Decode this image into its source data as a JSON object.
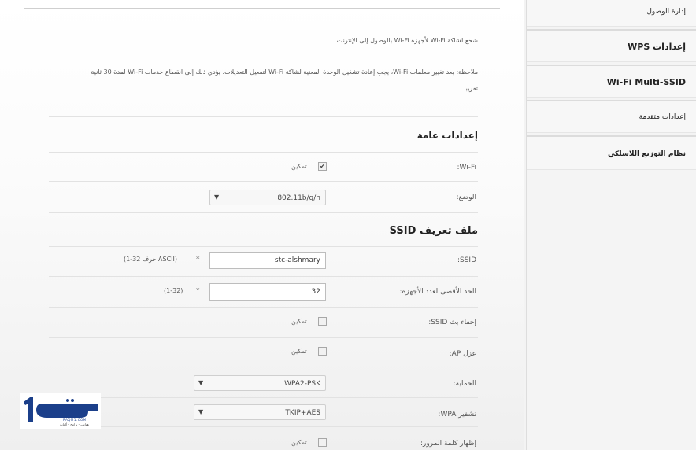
{
  "intro": {
    "line1": "شحع لشاكة Wi-Fi لأجهزة Wi-Fi بالوصول إلى الإنترنت.",
    "line2": "ملاحظة: بعد تغيير معلمات Wi-Fi، يجب إعادة تشغيل الوحدة المعنية لشاكة Wi-Fi لتفعيل التعديلات. يؤدي ذلك إلى انقطاع خدمات Wi-Fi لمدة 30 ثانية",
    "line3": "تقريبا."
  },
  "general": {
    "heading": "إعدادات عامة",
    "wifi_label": "Wi-Fi:",
    "wifi_enabled_text": "تمكين",
    "mode_label": "الوضع:",
    "mode_value": "802.11b/g/n"
  },
  "ssid_profile": {
    "heading": "ملف تعريف SSID",
    "ssid_label": "SSID:",
    "ssid_value": "stc-alshmary",
    "ssid_hint": "(1-32 حرف ASCII)",
    "max_devices_label": "الحد الأقصى لعدد الأجهزة:",
    "max_devices_value": "32",
    "max_devices_hint": "(1-32)",
    "required_mark": "*",
    "hide_ssid_label": "إخفاء بث SSID:",
    "hide_ssid_text": "تمكين",
    "ap_isolation_label": "عزل AP:",
    "ap_isolation_text": "تمكين",
    "security_label": "الحماية:",
    "security_value": "WPA2-PSK",
    "wpa_encryption_label": "تشفير WPA:",
    "wpa_encryption_value": "TKIP+AES",
    "show_password_label": "إظهار كلمة المرور:",
    "show_password_text": "تمكين"
  },
  "sidebar": {
    "items": [
      {
        "label": "إدارة الوصول"
      },
      {
        "label": "إعدادات WPS"
      },
      {
        "label": "Wi-Fi Multi-SSID"
      },
      {
        "label": "إعدادات متقدمة"
      },
      {
        "label": "نظام التوزيع اللاسلكي"
      }
    ]
  },
  "watermark": {
    "logo_text": "رقم1",
    "site": "RAQM1.COM",
    "tagline": "هواتف - برامج - ألعاب"
  },
  "icons": {
    "checkbox_checked": "check-icon",
    "dropdown": "caret-down-icon"
  },
  "colors": {
    "logo_blue": "#1b3f8a",
    "page_bg": "#ffffff",
    "sidebar_bg": "#f4f4f4"
  }
}
